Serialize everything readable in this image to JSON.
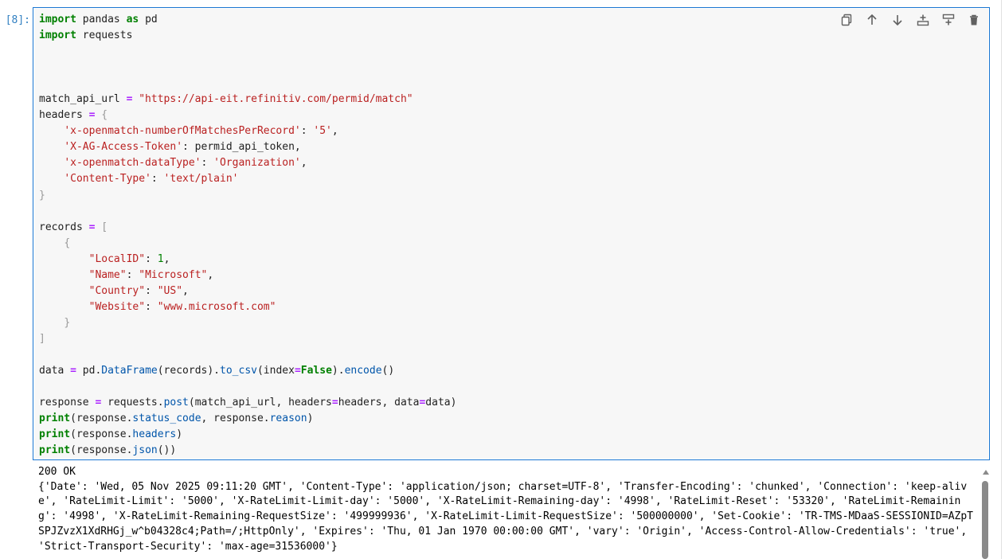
{
  "cell": {
    "prompt": "[8]:",
    "code_lines": [
      [
        {
          "t": "import",
          "c": "kw"
        },
        {
          "t": " pandas "
        },
        {
          "t": "as",
          "c": "kw"
        },
        {
          "t": " pd"
        }
      ],
      [
        {
          "t": "import",
          "c": "kw"
        },
        {
          "t": " requests"
        }
      ],
      [],
      [],
      [],
      [
        {
          "t": "match_api_url "
        },
        {
          "t": "=",
          "c": "op"
        },
        {
          "t": " "
        },
        {
          "t": "\"https://api-eit.refinitiv.com/permid/match\"",
          "c": "str"
        }
      ],
      [
        {
          "t": "headers "
        },
        {
          "t": "=",
          "c": "op"
        },
        {
          "t": " "
        },
        {
          "t": "{",
          "c": "brk"
        }
      ],
      [
        {
          "t": "    "
        },
        {
          "t": "'x-openmatch-numberOfMatchesPerRecord'",
          "c": "str"
        },
        {
          "t": ": "
        },
        {
          "t": "'5'",
          "c": "str"
        },
        {
          "t": ","
        }
      ],
      [
        {
          "t": "    "
        },
        {
          "t": "'X-AG-Access-Token'",
          "c": "str"
        },
        {
          "t": ": permid_api_token,"
        }
      ],
      [
        {
          "t": "    "
        },
        {
          "t": "'x-openmatch-dataType'",
          "c": "str"
        },
        {
          "t": ": "
        },
        {
          "t": "'Organization'",
          "c": "str"
        },
        {
          "t": ","
        }
      ],
      [
        {
          "t": "    "
        },
        {
          "t": "'Content-Type'",
          "c": "str"
        },
        {
          "t": ": "
        },
        {
          "t": "'text/plain'",
          "c": "str"
        }
      ],
      [
        {
          "t": "}",
          "c": "brk"
        }
      ],
      [],
      [
        {
          "t": "records "
        },
        {
          "t": "=",
          "c": "op"
        },
        {
          "t": " "
        },
        {
          "t": "[",
          "c": "brk"
        }
      ],
      [
        {
          "t": "    "
        },
        {
          "t": "{",
          "c": "brk"
        }
      ],
      [
        {
          "t": "        "
        },
        {
          "t": "\"LocalID\"",
          "c": "str"
        },
        {
          "t": ": "
        },
        {
          "t": "1",
          "c": "num"
        },
        {
          "t": ","
        }
      ],
      [
        {
          "t": "        "
        },
        {
          "t": "\"Name\"",
          "c": "str"
        },
        {
          "t": ": "
        },
        {
          "t": "\"Microsoft\"",
          "c": "str"
        },
        {
          "t": ","
        }
      ],
      [
        {
          "t": "        "
        },
        {
          "t": "\"Country\"",
          "c": "str"
        },
        {
          "t": ": "
        },
        {
          "t": "\"US\"",
          "c": "str"
        },
        {
          "t": ","
        }
      ],
      [
        {
          "t": "        "
        },
        {
          "t": "\"Website\"",
          "c": "str"
        },
        {
          "t": ": "
        },
        {
          "t": "\"www.microsoft.com\"",
          "c": "str"
        }
      ],
      [
        {
          "t": "    "
        },
        {
          "t": "}",
          "c": "brk"
        }
      ],
      [
        {
          "t": "]",
          "c": "brk"
        }
      ],
      [],
      [
        {
          "t": "data "
        },
        {
          "t": "=",
          "c": "op"
        },
        {
          "t": " pd."
        },
        {
          "t": "DataFrame",
          "c": "attr"
        },
        {
          "t": "(records)."
        },
        {
          "t": "to_csv",
          "c": "attr"
        },
        {
          "t": "(index"
        },
        {
          "t": "=",
          "c": "op"
        },
        {
          "t": "False",
          "c": "kw"
        },
        {
          "t": ")."
        },
        {
          "t": "encode",
          "c": "attr"
        },
        {
          "t": "()"
        }
      ],
      [],
      [
        {
          "t": "response "
        },
        {
          "t": "=",
          "c": "op"
        },
        {
          "t": " requests."
        },
        {
          "t": "post",
          "c": "attr"
        },
        {
          "t": "(match_api_url, headers"
        },
        {
          "t": "=",
          "c": "op"
        },
        {
          "t": "headers, data"
        },
        {
          "t": "=",
          "c": "op"
        },
        {
          "t": "data)"
        }
      ],
      [
        {
          "t": "print",
          "c": "kw"
        },
        {
          "t": "(response."
        },
        {
          "t": "status_code",
          "c": "attr"
        },
        {
          "t": ", response."
        },
        {
          "t": "reason",
          "c": "attr"
        },
        {
          "t": ")"
        }
      ],
      [
        {
          "t": "print",
          "c": "kw"
        },
        {
          "t": "(response."
        },
        {
          "t": "headers",
          "c": "attr"
        },
        {
          "t": ")"
        }
      ],
      [
        {
          "t": "print",
          "c": "kw"
        },
        {
          "t": "(response."
        },
        {
          "t": "json",
          "c": "attr"
        },
        {
          "t": "())"
        }
      ]
    ]
  },
  "toolbar": [
    {
      "name": "duplicate-icon",
      "label": "Duplicate cell"
    },
    {
      "name": "arrow-up-icon",
      "label": "Move cell up"
    },
    {
      "name": "arrow-down-icon",
      "label": "Move cell down"
    },
    {
      "name": "insert-above-icon",
      "label": "Insert cell above"
    },
    {
      "name": "insert-below-icon",
      "label": "Insert cell below"
    },
    {
      "name": "trash-icon",
      "label": "Delete cell"
    }
  ],
  "output": {
    "lines": [
      "200 OK",
      "{'Date': 'Wed, 05 Nov 2025 09:11:20 GMT', 'Content-Type': 'application/json; charset=UTF-8', 'Transfer-Encoding': 'chunked', 'Connection': 'keep-aliv",
      "e', 'RateLimit-Limit': '5000', 'X-RateLimit-Limit-day': '5000', 'X-RateLimit-Remaining-day': '4998', 'RateLimit-Reset': '53320', 'RateLimit-Remainin",
      "g': '4998', 'X-RateLimit-Remaining-RequestSize': '499999936', 'X-RateLimit-Limit-RequestSize': '500000000', 'Set-Cookie': 'TR-TMS-MDaaS-SESSIONID=AZpT",
      "SPJZvzX1XdRHGj_w^b04328c4;Path=/;HttpOnly', 'Expires': 'Thu, 01 Jan 1970 00:00:00 GMT', 'vary': 'Origin', 'Access-Control-Allow-Credentials': 'true',",
      "'Strict-Transport-Security': 'max-age=31536000'}"
    ]
  },
  "colors": {
    "accent": "#1976d2",
    "prompt": "#307fc1",
    "keyword": "#008000",
    "string": "#ba2121",
    "attribute": "#0055aa"
  }
}
